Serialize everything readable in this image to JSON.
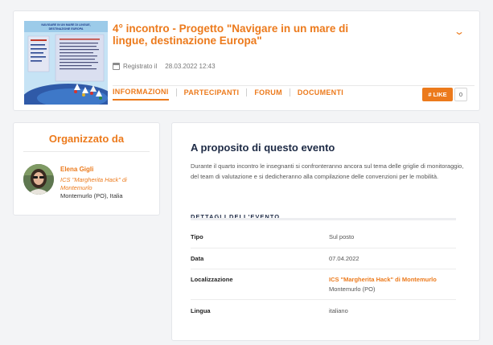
{
  "event": {
    "title": "4° incontro - Progetto \"Navigare in un mare di lingue, destinazione Europa\"",
    "registered_label": "Registrato il",
    "registered_date": "28.03.2022 12:43",
    "tabs": [
      "INFORMAZIONI",
      "PARTECIPANTI",
      "FORUM",
      "DOCUMENTI"
    ],
    "active_tab": "INFORMAZIONI",
    "like_label": "# LIKE",
    "like_count": "0",
    "thumbnail": {
      "line1": "NAVIGARE IN UN MARE DI LINGUE,",
      "line2": "DESTINAZIONE EUROPA"
    }
  },
  "organizer": {
    "heading": "Organizzato da",
    "name": "Elena Gigli",
    "school": "ICS \"Margherita Hack\" di Montemurlo",
    "place": "Montemurlo (PO), Italia"
  },
  "about": {
    "heading": "A proposito di questo evento",
    "description": "Durante il quarto incontro le insegnanti si confronteranno ancora sul tema delle griglie di monitoraggio, del team di valutazione e si dedicheranno alla compilazione delle convenzioni per le mobilità."
  },
  "details": {
    "heading": "DETTAGLI DELL'EVENTO",
    "rows": [
      {
        "label": "Tipo",
        "value": "Sul posto"
      },
      {
        "label": "Data",
        "value": "07.04.2022"
      },
      {
        "label": "Localizzazione",
        "value": "ICS \"Margherita Hack\" di Montemurlo",
        "sub": "Montemurlo (PO)"
      },
      {
        "label": "Lingua",
        "value": "italiano"
      }
    ]
  },
  "colors": {
    "accent": "#ec7a1c",
    "heading": "#1d2a45",
    "background": "#f3f4f6"
  }
}
